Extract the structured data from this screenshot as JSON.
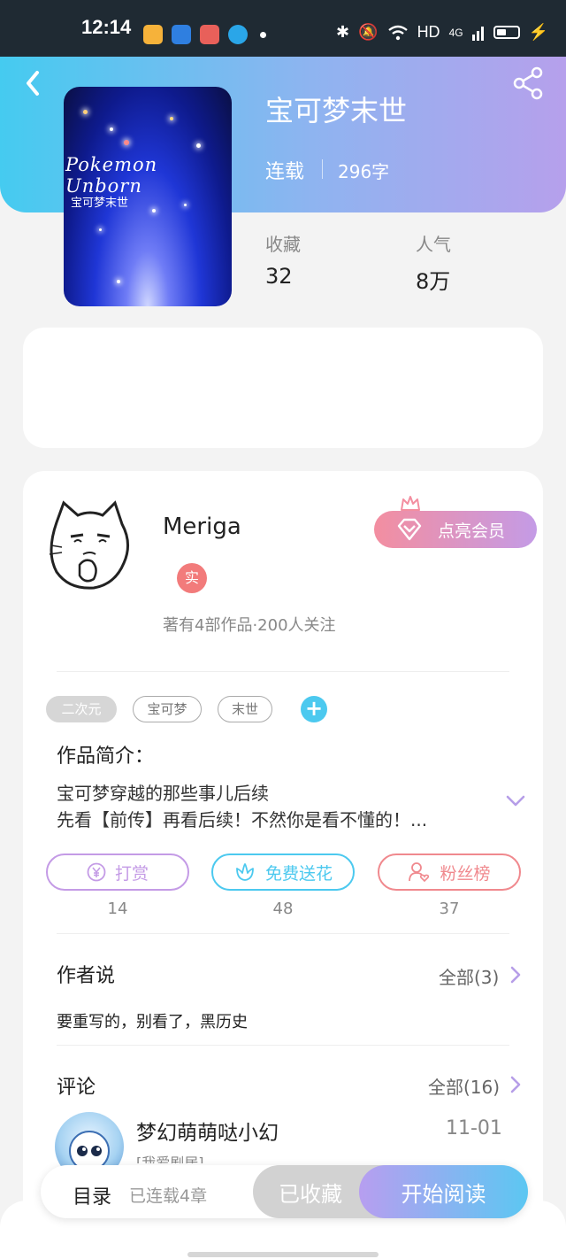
{
  "status_bar": {
    "time": "12:14",
    "network": "HD",
    "signal_label": "4G",
    "app_icons": [
      "weibo-icon",
      "browser-icon",
      "game-icon",
      "qq-icon"
    ]
  },
  "book": {
    "title": "宝可梦末世",
    "status": "连载",
    "word_count": "296字",
    "cover_title": "Pokemon Unborn",
    "cover_subtitle": "宝可梦末世"
  },
  "stats": [
    {
      "label": "收藏",
      "value": "32"
    },
    {
      "label": "人气",
      "value": "8万"
    }
  ],
  "author": {
    "name": "Meriga",
    "badge": "实",
    "meta": "著有4部作品·200人关注",
    "vip_button": "点亮会员"
  },
  "tags": [
    "二次元",
    "宝可梦",
    "末世"
  ],
  "intro": {
    "title": "作品简介：",
    "lines": [
      "宝可梦穿越的那些事儿后续",
      "先看【前传】再看后续！不然你是看不懂的！..."
    ]
  },
  "actions": [
    {
      "label": "打赏",
      "count": "14",
      "color": "#c49be6"
    },
    {
      "label": "免费送花",
      "count": "48",
      "color": "#4cc9ef"
    },
    {
      "label": "粉丝榜",
      "count": "37",
      "color": "#f0898e"
    }
  ],
  "author_says": {
    "title": "作者说",
    "more": "全部(3)",
    "note": "要重写的，别看了，黑历史"
  },
  "comments": {
    "title": "评论",
    "more": "全部(16)",
    "first": {
      "name": "梦幻萌萌哒小幻",
      "date": "11-01",
      "tag": "[我爱剧居]"
    }
  },
  "bottom": {
    "catalog": "目录",
    "catalog_sub": "已连载4章",
    "collected": "已收藏",
    "read": "开始阅读"
  },
  "colors": {
    "accent_blue": "#45cbf0",
    "accent_purple": "#b6a0ec",
    "badge_red": "#f27b7b"
  }
}
